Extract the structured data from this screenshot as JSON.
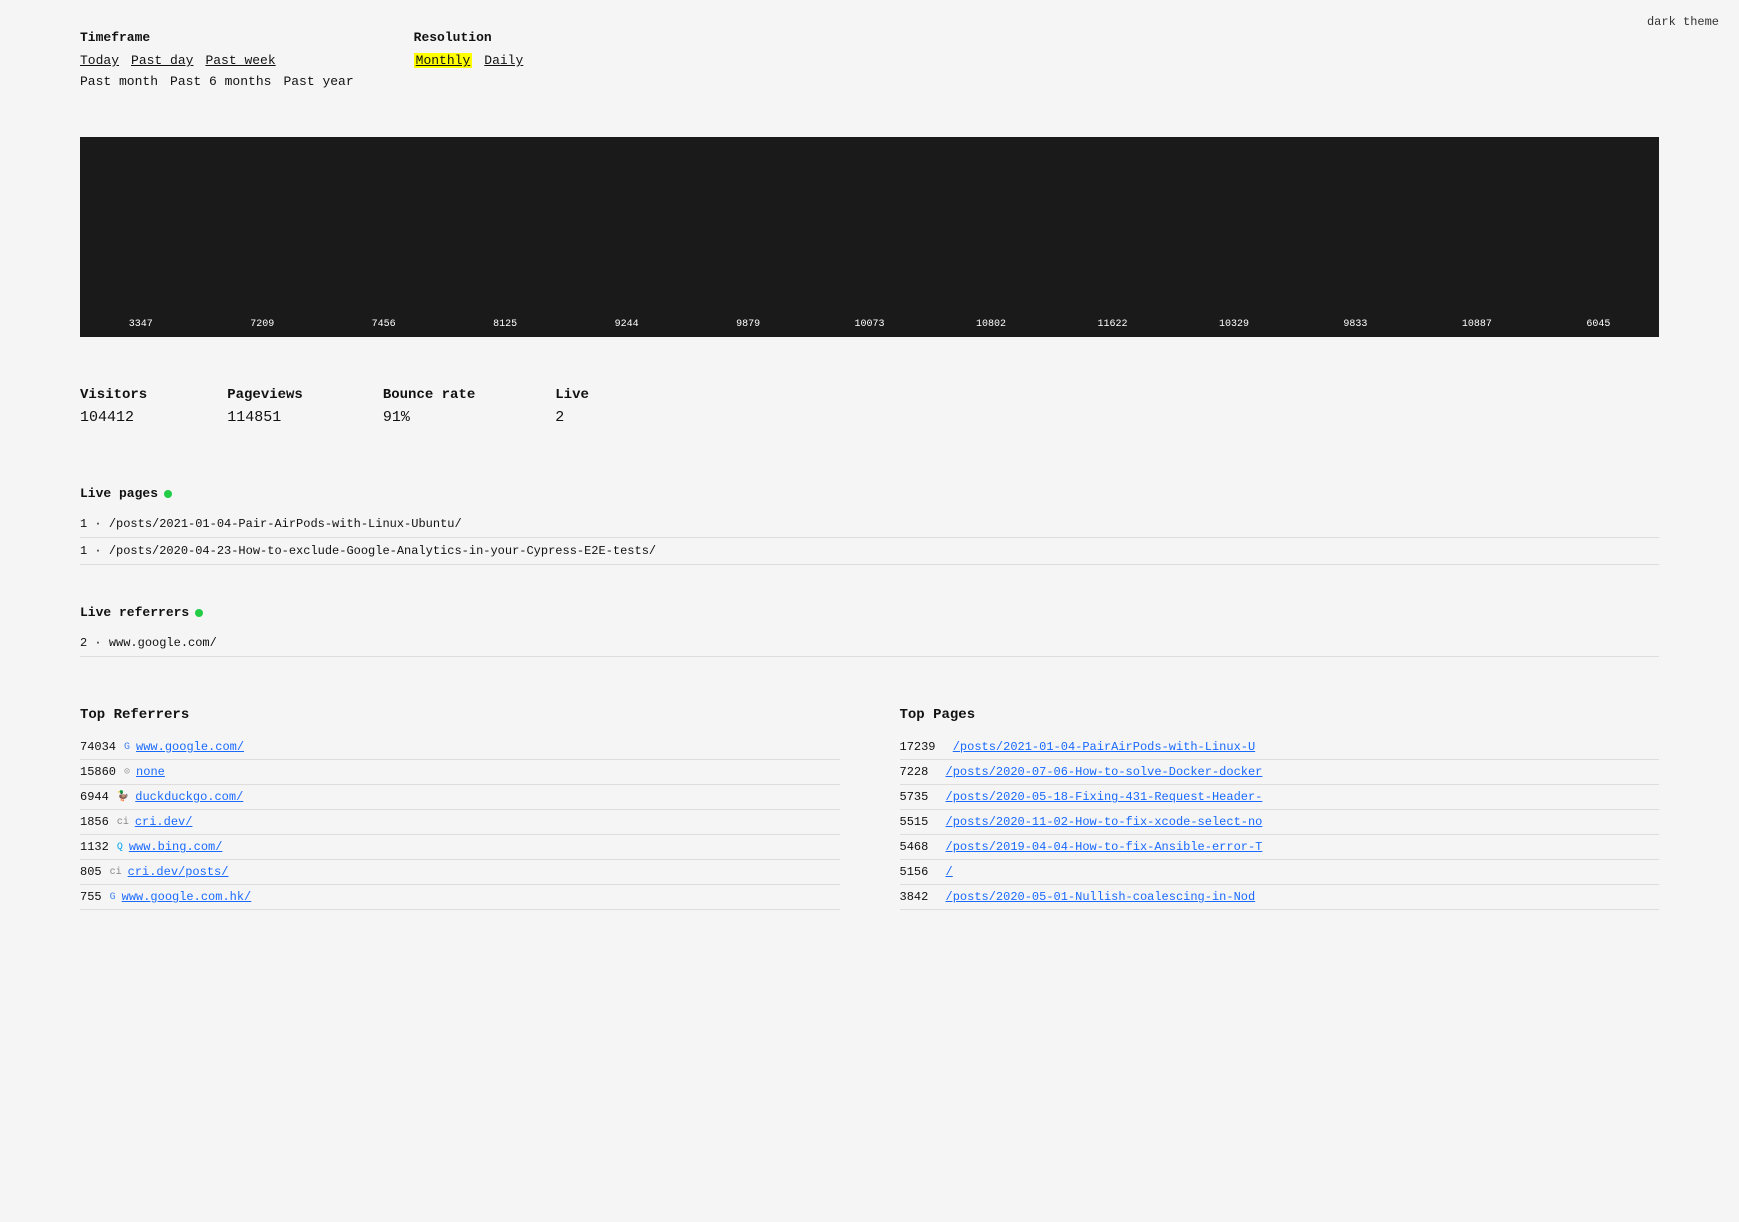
{
  "topRight": {
    "label": "dark theme"
  },
  "timeframe": {
    "label": "Timeframe",
    "options": [
      {
        "id": "today",
        "text": "Today",
        "active": false
      },
      {
        "id": "past-day",
        "text": "Past day",
        "active": false
      },
      {
        "id": "past-week",
        "text": "Past week",
        "active": false
      },
      {
        "id": "past-month",
        "text": "Past month",
        "active": false
      },
      {
        "id": "past-6-months",
        "text": "Past 6 months",
        "active": false
      },
      {
        "id": "past-year",
        "text": "Past year",
        "active": true
      }
    ]
  },
  "resolution": {
    "label": "Resolution",
    "options": [
      {
        "id": "monthly",
        "text": "Monthly",
        "active": true
      },
      {
        "id": "daily",
        "text": "Daily",
        "active": false
      }
    ]
  },
  "chart": {
    "bars": [
      {
        "label": "3347",
        "value": 3347
      },
      {
        "label": "7209",
        "value": 7209
      },
      {
        "label": "7456",
        "value": 7456
      },
      {
        "label": "8125",
        "value": 8125
      },
      {
        "label": "9244",
        "value": 9244
      },
      {
        "label": "9879",
        "value": 9879
      },
      {
        "label": "10073",
        "value": 10073
      },
      {
        "label": "10802",
        "value": 10802
      },
      {
        "label": "11622",
        "value": 11622
      },
      {
        "label": "10329",
        "value": 10329
      },
      {
        "label": "9833",
        "value": 9833
      },
      {
        "label": "10887",
        "value": 10887
      },
      {
        "label": "6045",
        "value": 6045
      }
    ],
    "maxValue": 12000
  },
  "stats": {
    "visitors": {
      "label": "Visitors",
      "value": "104412"
    },
    "pageviews": {
      "label": "Pageviews",
      "value": "114851"
    },
    "bounceRate": {
      "label": "Bounce rate",
      "value": "91%"
    },
    "live": {
      "label": "Live",
      "value": "2"
    }
  },
  "livePages": {
    "title": "Live pages",
    "items": [
      {
        "count": "1",
        "url": "/posts/2021-01-04-Pair-AirPods-with-Linux-Ubuntu/"
      },
      {
        "count": "1",
        "url": "/posts/2020-04-23-How-to-exclude-Google-Analytics-in-your-Cypress-E2E-tests/"
      }
    ]
  },
  "liveReferrers": {
    "title": "Live referrers",
    "items": [
      {
        "count": "2",
        "url": "www.google.com/"
      }
    ]
  },
  "topReferrers": {
    "title": "Top Referrers",
    "items": [
      {
        "count": "74034",
        "icon": "G",
        "iconType": "google",
        "url": "www.google.com/"
      },
      {
        "count": "15860",
        "icon": "⊙",
        "iconType": "none",
        "url": "none"
      },
      {
        "count": "6944",
        "icon": "🦆",
        "iconType": "dd",
        "url": "duckduckgo.com/"
      },
      {
        "count": "1856",
        "icon": "ci",
        "iconType": "cri",
        "url": "cri.dev/"
      },
      {
        "count": "1132",
        "icon": "Q",
        "iconType": "bing",
        "url": "www.bing.com/"
      },
      {
        "count": "805",
        "icon": "ci",
        "iconType": "cri",
        "url": "cri.dev/posts/"
      },
      {
        "count": "755",
        "icon": "G",
        "iconType": "google",
        "url": "www.google.com.hk/"
      }
    ]
  },
  "topPages": {
    "title": "Top Pages",
    "items": [
      {
        "count": "17239",
        "url": "/posts/2021-01-04-PairAirPods-with-Linux-U"
      },
      {
        "count": "7228",
        "url": "/posts/2020-07-06-How-to-solve-Docker-docker"
      },
      {
        "count": "5735",
        "url": "/posts/2020-05-18-Fixing-431-Request-Header-"
      },
      {
        "count": "5515",
        "url": "/posts/2020-11-02-How-to-fix-xcode-select-no"
      },
      {
        "count": "5468",
        "url": "/posts/2019-04-04-How-to-fix-Ansible-error-T"
      },
      {
        "count": "5156",
        "url": "/"
      },
      {
        "count": "3842",
        "url": "/posts/2020-05-01-Nullish-coalescing-in-Nod"
      }
    ]
  }
}
